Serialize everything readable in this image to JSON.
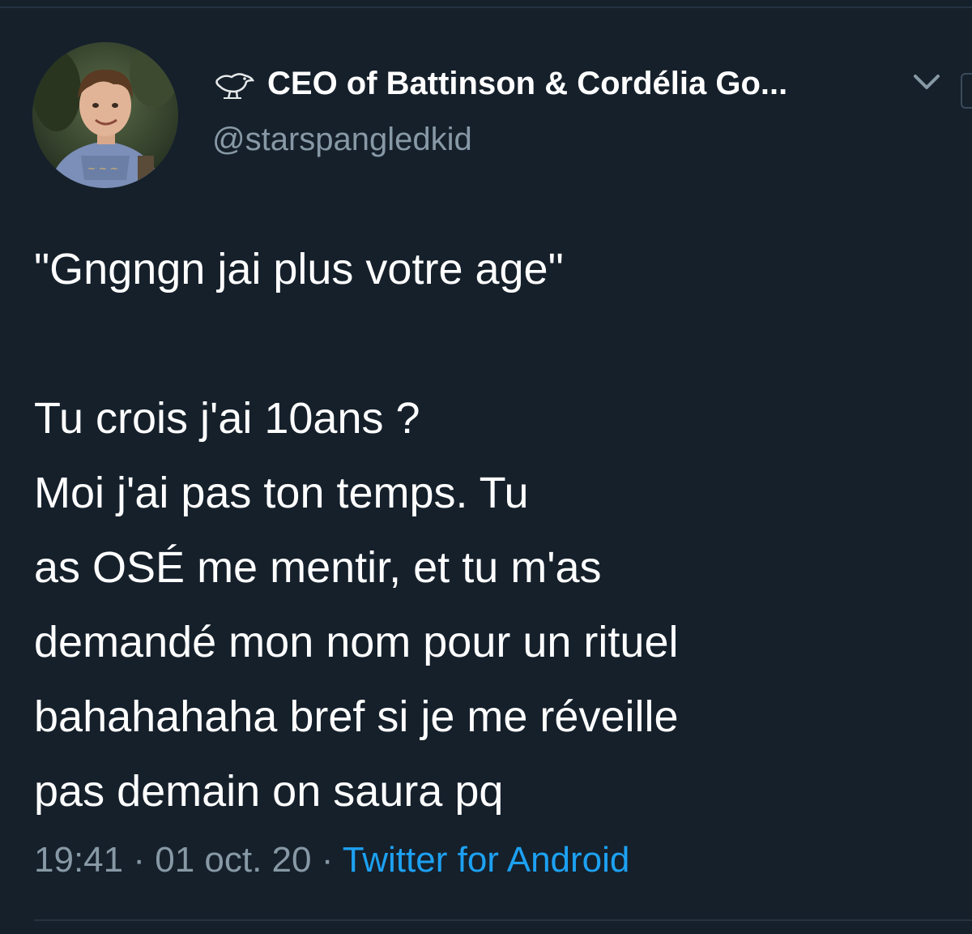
{
  "tweet": {
    "author": {
      "display_name": "CEO of Battinson & Cordélia Go...",
      "handle": "@starspangledkid",
      "name_emoji_icon": "bird-icon",
      "avatar_icon": "avatar"
    },
    "menu_icon": "chevron-down-icon",
    "text_lines": [
      "\"Gngngn jai plus votre age\"",
      "",
      "Tu crois j'ai 10ans ?",
      "Moi j'ai pas ton temps. Tu",
      "as OSÉ me mentir, et tu m'as",
      "demandé mon nom pour un rituel",
      "bahahahaha bref si je me réveille",
      "pas demain on saura pq"
    ],
    "time": "19:41",
    "separator": " · ",
    "date": "01 oct. 20",
    "source": "Twitter for Android"
  },
  "colors": {
    "background": "#15202b",
    "text_primary": "#ffffff",
    "text_secondary": "#8899a6",
    "link": "#1da1f2"
  }
}
